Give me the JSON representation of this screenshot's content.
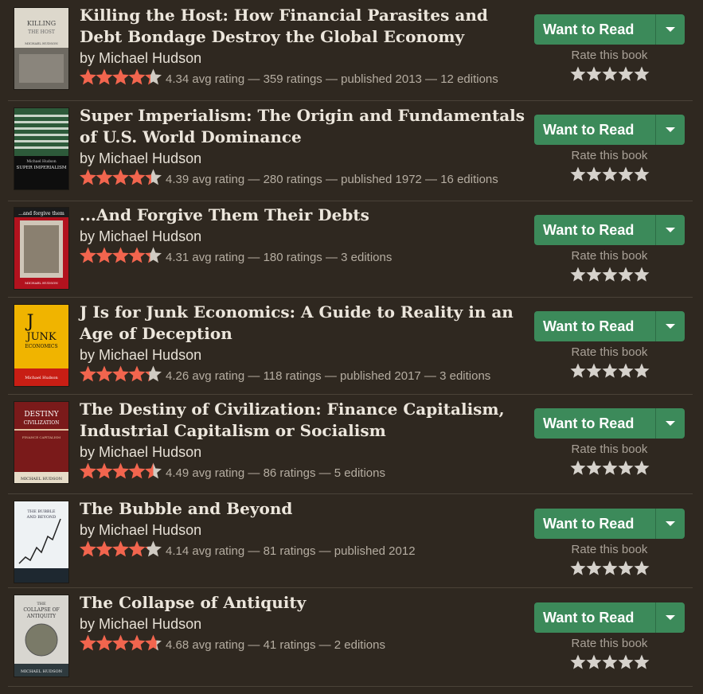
{
  "books": [
    {
      "title": "Killing the Host: How Financial Parasites and Debt Bondage Destroy the Global Economy",
      "by": "by",
      "author": "Michael Hudson",
      "meta": "4.34 avg rating — 359 ratings — published 2013 — 12 editions",
      "avg": 4.34,
      "cover": {
        "bg": "#ddd8cc",
        "band": "#3a3a3a",
        "text": "KILLING THE HOST",
        "sub": "MICHAEL HUDSON",
        "textColor": "#333"
      }
    },
    {
      "title": "Super Imperialism: The Origin and Fundamentals of U.S. World Dominance",
      "by": "by",
      "author": "Michael Hudson",
      "meta": "4.39 avg rating — 280 ratings — published 1972 — 16 editions",
      "avg": 4.39,
      "cover": {
        "bg": "#1e3a28",
        "band": "#0e0e0e",
        "text": "SUPER IMPERIALISM",
        "sub": "Michael Hudson",
        "textColor": "#e8e8e8"
      }
    },
    {
      "title": "...And Forgive Them Their Debts",
      "by": "by",
      "author": "Michael Hudson",
      "meta": "4.31 avg rating — 180 ratings — 3 editions",
      "avg": 4.31,
      "cover": {
        "bg": "#b2121e",
        "band": "#cfc6b8",
        "text": "...and forgive them their debts",
        "sub": "MICHAEL HUDSON",
        "textColor": "#fff"
      }
    },
    {
      "title": "J Is for Junk Economics: A Guide to Reality in an Age of Deception",
      "by": "by",
      "author": "Michael Hudson",
      "meta": "4.26 avg rating — 118 ratings — published 2017 — 3 editions",
      "avg": 4.26,
      "cover": {
        "bg": "#f0b400",
        "band": "#c81e14",
        "text": "J IS FOR JUNK ECONOMICS",
        "sub": "Michael Hudson",
        "textColor": "#222"
      }
    },
    {
      "title": "The Destiny of Civilization: Finance Capitalism, Industrial Capitalism or Socialism",
      "by": "by",
      "author": "Michael Hudson",
      "meta": "4.49 avg rating — 86 ratings — 5 editions",
      "avg": 4.49,
      "cover": {
        "bg": "#7a1a1a",
        "band": "#e6dcc8",
        "text": "THE DESTINY OF CIVILIZATION",
        "sub": "MICHAEL HUDSON",
        "textColor": "#f2e8d6"
      }
    },
    {
      "title": "The Bubble and Beyond",
      "by": "by",
      "author": "Michael Hudson",
      "meta": "4.14 avg rating — 81 ratings — published 2012",
      "avg": 4.14,
      "cover": {
        "bg": "#eef2f4",
        "band": "#1e2830",
        "text": "THE BUBBLE AND BEYOND",
        "sub": "Michael Hudson",
        "textColor": "#223"
      }
    },
    {
      "title": "The Collapse of Antiquity",
      "by": "by",
      "author": "Michael Hudson",
      "meta": "4.68 avg rating — 41 ratings — 2 editions",
      "avg": 4.68,
      "cover": {
        "bg": "#d8d6d0",
        "band": "#2e3a3e",
        "text": "THE COLLAPSE OF ANTIQUITY",
        "sub": "MICHAEL HUDSON",
        "textColor": "#333"
      }
    }
  ],
  "labels": {
    "want_to_read": "Want to Read",
    "rate_this_book": "Rate this book"
  },
  "colors": {
    "star_filled": "#f2654e",
    "star_empty_rate": "#d6d2cc",
    "button": "#3c8a5a"
  }
}
